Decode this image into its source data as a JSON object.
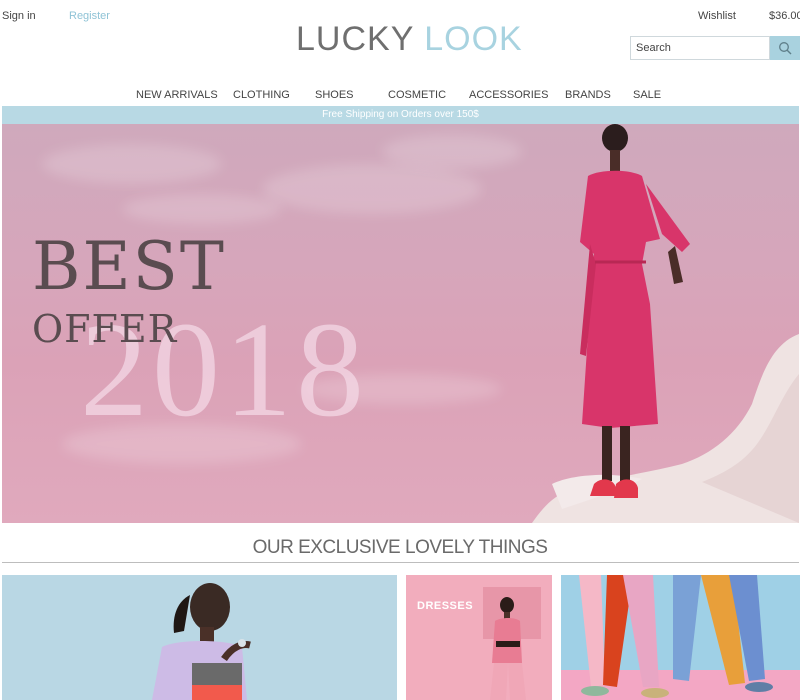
{
  "header": {
    "sign_in": "Sign in",
    "register": "Register",
    "wishlist": "Wishlist",
    "cart_total": "$36.00",
    "logo_part1": "LUCKY",
    "logo_part2": "LOOK",
    "search_placeholder": "Search",
    "search_icon": "search-icon"
  },
  "nav": {
    "items": [
      "NEW ARRIVALS",
      "CLOTHING",
      "SHOES",
      "COSMETIC",
      "ACCESSORIES",
      "BRANDS",
      "SALE"
    ]
  },
  "banner": {
    "text": "Free Shipping on Orders over 150$"
  },
  "hero": {
    "line1": "BEST",
    "line2": "OFFER",
    "year": "2018"
  },
  "section": {
    "title": "OUR EXCLUSIVE LOVELY THINGS"
  },
  "tiles": {
    "items": [
      {
        "label": ""
      },
      {
        "label": "DRESSES"
      },
      {
        "label": ""
      }
    ]
  },
  "colors": {
    "accent": "#a9d2df",
    "logo_gray": "#6f6f6f",
    "logo_blue": "#a8d3e0",
    "hero_text": "#5a4c50",
    "banner": "#b8d9e4"
  }
}
